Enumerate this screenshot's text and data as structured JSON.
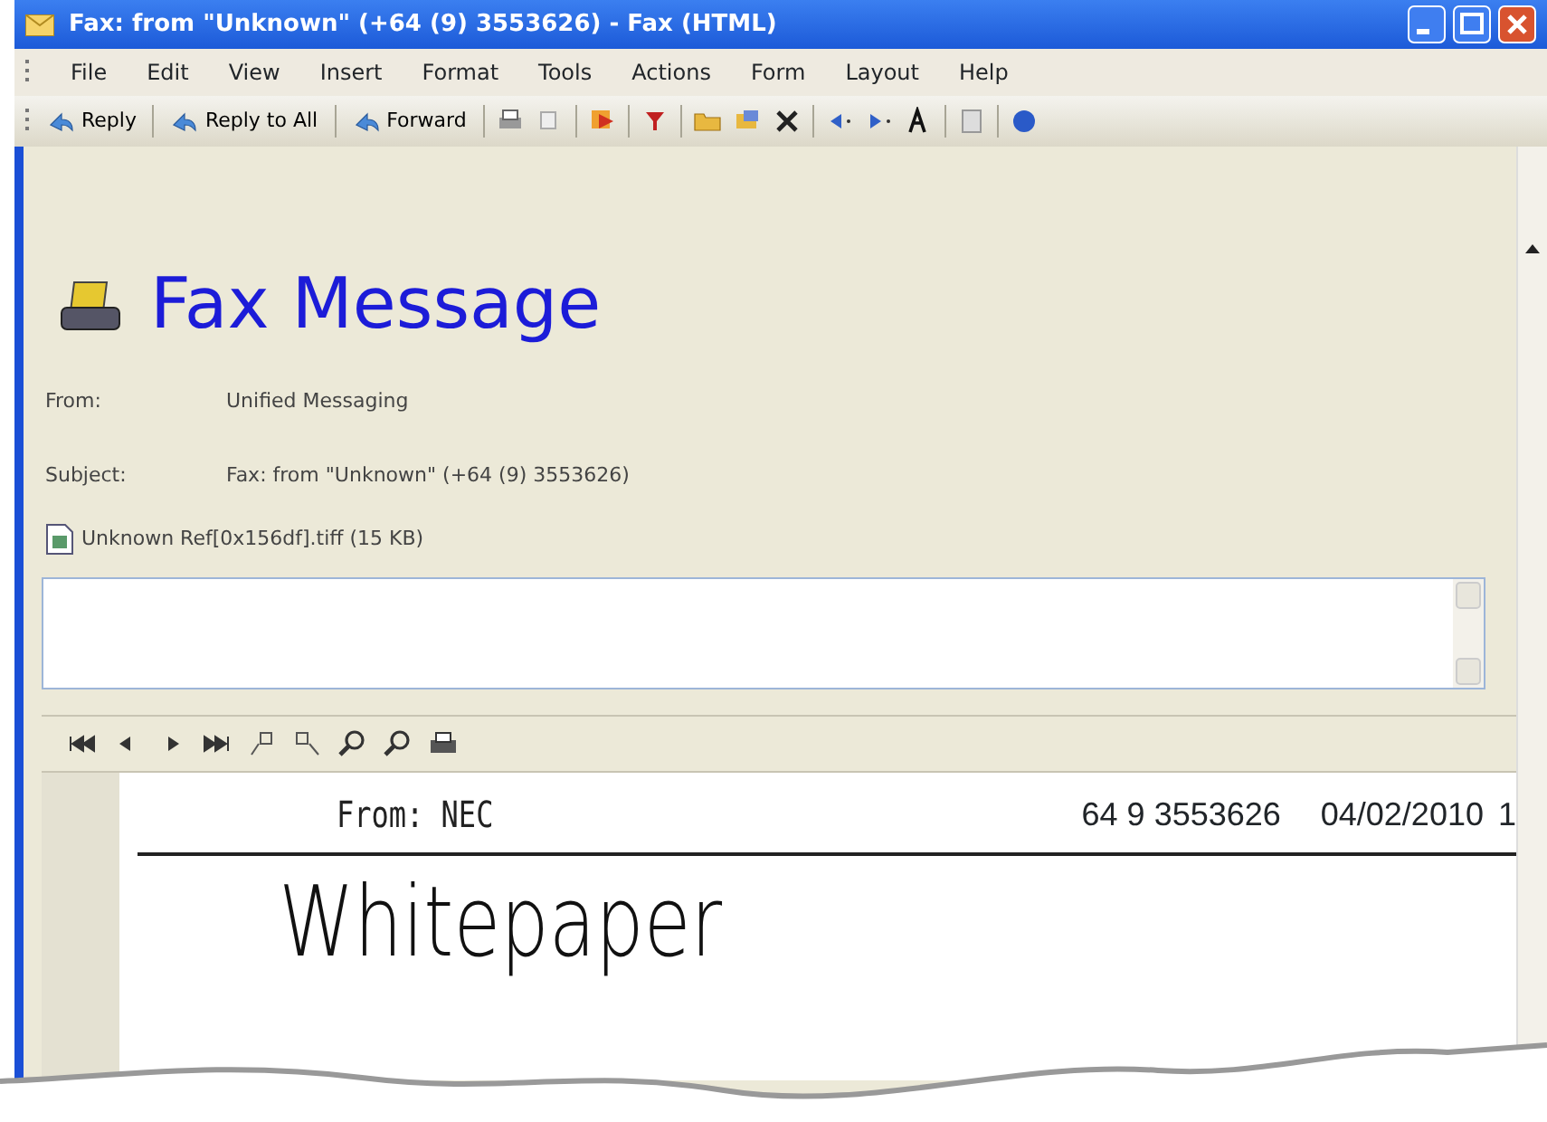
{
  "window": {
    "title": "Fax: from \"Unknown\" (+64 (9) 3553626) - Fax (HTML)"
  },
  "menu": [
    "File",
    "Edit",
    "View",
    "Insert",
    "Format",
    "Tools",
    "Actions",
    "Form",
    "Layout",
    "Help"
  ],
  "toolbar": {
    "buttons": [
      "Reply",
      "Reply to All",
      "Forward"
    ]
  },
  "message": {
    "title": "Fax Message",
    "fields": [
      {
        "label": "From:",
        "value": "Unified Messaging"
      },
      {
        "label": "Subject:",
        "value": "Fax: from \"Unknown\" (+64 (9) 3553626)"
      }
    ],
    "attachment": "Unknown Ref[0x156df].tiff (15 KB)"
  },
  "fax_page": {
    "from": "From: NEC",
    "number": "64 9 3553626",
    "date": "04/02/2010",
    "cut_text": "1",
    "heading": "Whitepaper"
  }
}
